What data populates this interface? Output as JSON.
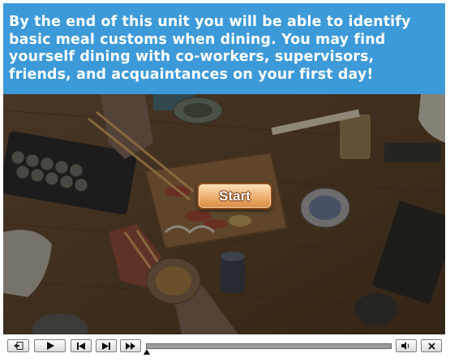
{
  "header": {
    "text": "By the end of this unit you will be able to identify basic meal customs when dining. You may find yourself dining with co-workers, supervisors, friends, and acquaintances on your first day!"
  },
  "stage": {
    "start_label": "Start",
    "background": "dimmed photo of a dining table with sushi, chopsticks and small dishes"
  },
  "controls": {
    "exit_icon": "exit-icon",
    "play_icon": "play-icon",
    "previous_icon": "skip-previous-icon",
    "next_icon": "skip-next-icon",
    "fast_forward_icon": "fast-forward-icon",
    "volume_icon": "volume-icon",
    "close_icon": "close-icon",
    "progress": 0.0
  },
  "colors": {
    "header_bg": "#3d9ad9",
    "header_text": "#ffffff",
    "start_button": "#f0b87a",
    "start_border": "#8a4a18"
  }
}
